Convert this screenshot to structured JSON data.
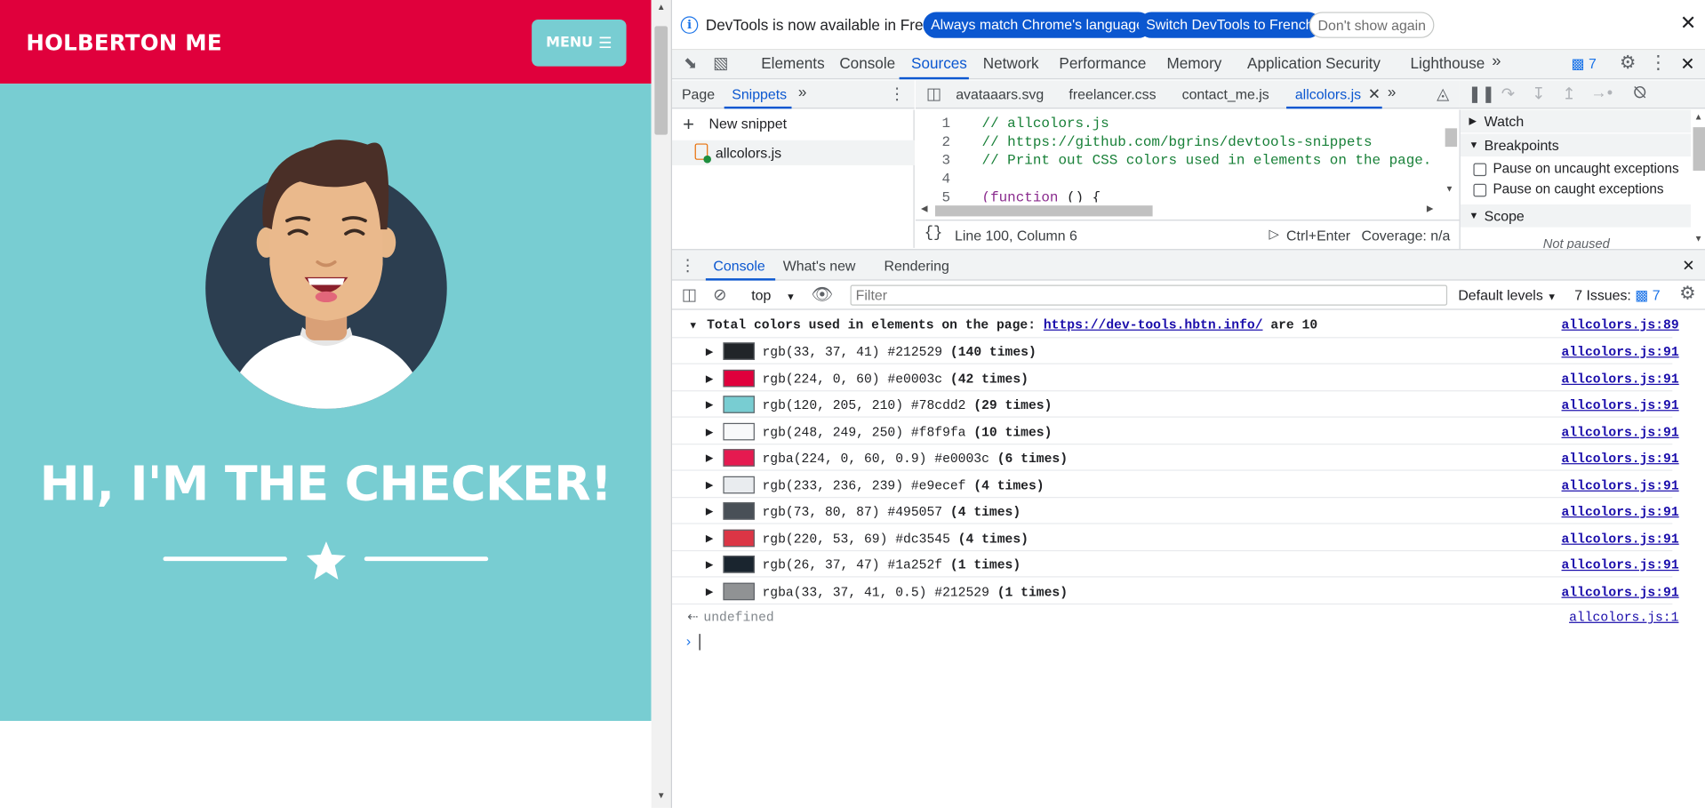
{
  "page": {
    "brand": "HOLBERTON ME",
    "menu_label": "MENU",
    "hero_title": "HI, I'M THE CHECKER!"
  },
  "devtools": {
    "infobar": {
      "text": "DevTools is now available in French!",
      "btn_match": "Always match Chrome's language",
      "btn_switch": "Switch DevTools to French",
      "btn_dismiss": "Don't show again"
    },
    "main_tabs": [
      "Elements",
      "Console",
      "Sources",
      "Network",
      "Performance",
      "Memory",
      "Application",
      "Security",
      "Lighthouse"
    ],
    "active_tab": "Sources",
    "issues_count": "7",
    "navigator_tabs": [
      "Page",
      "Snippets"
    ],
    "new_snippet": "New snippet",
    "snippet_file": "allcolors.js",
    "editor_tabs": [
      "avataaars.svg",
      "freelancer.css",
      "contact_me.js",
      "allcolors.js"
    ],
    "code_lines": [
      {
        "n": "1",
        "text": "// allcolors.js"
      },
      {
        "n": "2",
        "text": "// https://github.com/bgrins/devtools-snippets"
      },
      {
        "n": "3",
        "text": "// Print out CSS colors used in elements on the page."
      },
      {
        "n": "4",
        "text": ""
      },
      {
        "n": "5",
        "kw": "(function",
        "rest": " () {"
      }
    ],
    "status_position": "Line 100, Column 6",
    "status_run": "Ctrl+Enter",
    "status_coverage": "Coverage: n/a",
    "debugger": {
      "watch": "Watch",
      "breakpoints": "Breakpoints",
      "pause_uncaught": "Pause on uncaught exceptions",
      "pause_caught": "Pause on caught exceptions",
      "scope": "Scope",
      "not_paused": "Not paused"
    },
    "drawer_tabs": [
      "Console",
      "What's new",
      "Rendering"
    ],
    "console_toolbar": {
      "context": "top",
      "filter_placeholder": "Filter",
      "levels": "Default levels",
      "issues_label": "7 Issues:",
      "issues_count": "7"
    },
    "console_summary": {
      "prefix": "Total colors used in elements on the page: ",
      "url": "https://dev-tools.hbtn.info/",
      "suffix": " are 10",
      "source": "allcolors.js:89"
    },
    "colors": [
      {
        "swatch": "#212529",
        "value": "rgb(33, 37, 41) #212529",
        "count": "(140 times)",
        "source": "allcolors.js:91"
      },
      {
        "swatch": "#e0003c",
        "value": "rgb(224, 0, 60) #e0003c",
        "count": "(42 times)",
        "source": "allcolors.js:91"
      },
      {
        "swatch": "#78cdd2",
        "value": "rgb(120, 205, 210) #78cdd2",
        "count": "(29 times)",
        "source": "allcolors.js:91"
      },
      {
        "swatch": "#f8f9fa",
        "value": "rgb(248, 249, 250) #f8f9fa",
        "count": "(10 times)",
        "source": "allcolors.js:91"
      },
      {
        "swatch": "#e51a50",
        "value": "rgba(224, 0, 60, 0.9) #e0003c",
        "count": "(6 times)",
        "source": "allcolors.js:91"
      },
      {
        "swatch": "#e9ecef",
        "value": "rgb(233, 236, 239) #e9ecef",
        "count": "(4 times)",
        "source": "allcolors.js:91"
      },
      {
        "swatch": "#495057",
        "value": "rgb(73, 80, 87) #495057",
        "count": "(4 times)",
        "source": "allcolors.js:91"
      },
      {
        "swatch": "#dc3545",
        "value": "rgb(220, 53, 69) #dc3545",
        "count": "(4 times)",
        "source": "allcolors.js:91"
      },
      {
        "swatch": "#1a252f",
        "value": "rgb(26, 37, 47) #1a252f",
        "count": "(1 times)",
        "source": "allcolors.js:91"
      },
      {
        "swatch": "#909294",
        "value": "rgba(33, 37, 41, 0.5) #212529",
        "count": "(1 times)",
        "source": "allcolors.js:91"
      }
    ],
    "return_value": "undefined",
    "return_source": "allcolors.js:1"
  }
}
